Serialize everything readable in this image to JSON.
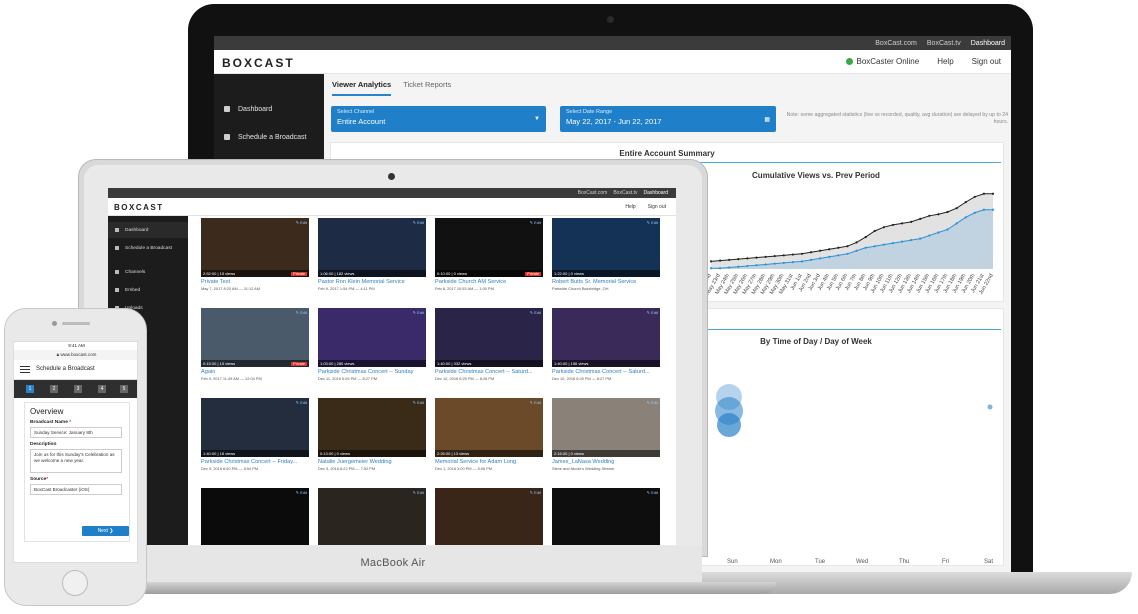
{
  "pro": {
    "topbar": [
      "BoxCast.com",
      "BoxCast.tv",
      "Dashboard"
    ],
    "logo": "BOXCAST",
    "status": "BoxCaster Online",
    "help": "Help",
    "signout": "Sign out",
    "sidebar": [
      "Dashboard",
      "Schedule a Broadcast"
    ],
    "tabs": [
      "Viewer Analytics",
      "Ticket Reports"
    ],
    "channel_label": "Select Channel",
    "channel_value": "Entire Account",
    "date_label": "Select Date Range",
    "date_value": "May 22, 2017 - Jun 22, 2017",
    "note": "Note: some aggregated statistics (live vs recorded, quality, avg duration) are delayed by up to 24 hours.",
    "summary_title": "Entire Account Summary",
    "cumulative_title": "Cumulative Views vs. Prev Period",
    "x_dates": [
      "May 22nd",
      "May 23rd",
      "May 24th",
      "May 25th",
      "May 26th",
      "May 27th",
      "May 28th",
      "May 29th",
      "May 30th",
      "May 31st",
      "Jun 1st",
      "Jun 2nd",
      "Jun 3rd",
      "Jun 4th",
      "Jun 5th",
      "Jun 6th",
      "Jun 7th",
      "Jun 8th",
      "Jun 9th",
      "Jun 10th",
      "Jun 11th",
      "Jun 12th",
      "Jun 13th",
      "Jun 14th",
      "Jun 15th",
      "Jun 16th",
      "Jun 17th",
      "Jun 18th",
      "Jun 19th",
      "Jun 20th",
      "Jun 21st",
      "Jun 22nd"
    ],
    "time_title": "By Time of Day / Day of Week",
    "days": [
      "Sun",
      "Mon",
      "Tue",
      "Wed",
      "Thu",
      "Fri",
      "Sat"
    ]
  },
  "chart_data": {
    "type": "area",
    "title": "Cumulative Views vs. Prev Period",
    "series": [
      {
        "color": "#8c8c8c",
        "values": [
          10,
          11,
          12,
          13,
          14,
          15,
          16,
          17,
          18,
          19,
          20,
          22,
          24,
          26,
          28,
          30,
          35,
          42,
          50,
          55,
          58,
          60,
          62,
          66,
          70,
          72,
          75,
          80,
          88,
          95,
          99,
          99
        ]
      },
      {
        "color": "#2a92d8",
        "values": [
          1,
          1,
          2,
          3,
          4,
          5,
          6,
          7,
          8,
          9,
          10,
          12,
          14,
          16,
          18,
          20,
          24,
          28,
          30,
          32,
          34,
          36,
          38,
          40,
          44,
          48,
          52,
          60,
          68,
          74,
          78,
          78
        ]
      }
    ]
  },
  "air": {
    "topbar": [
      "BoxCast.com",
      "BoxCast.tv",
      "Dashboard"
    ],
    "logo": "BOXCAST",
    "help": "Help",
    "signout": "Sign out",
    "sidebar": [
      "Dashboard",
      "Schedule a Broadcast",
      "Channels",
      "Embed",
      "Uploads",
      "Player"
    ],
    "videos": [
      {
        "title": "Private Test",
        "date": "May 7, 2017 8:20 AM — 11:12 AM",
        "meta": "2:52:00 | 15 views",
        "private": true,
        "bg": "#3c2a1d"
      },
      {
        "title": "Pastor Ron Klein Memorial Service",
        "date": "Feb 9, 2017 1:54 PM — 4:11 PM",
        "meta": "1:06:00 | 182 views",
        "private": false,
        "bg": "#1d2b45"
      },
      {
        "title": "Parkside Church AM Service",
        "date": "Feb 8, 2017 10:53 AM — 1:00 PM",
        "meta": "0:10:00 | 0 views",
        "private": true,
        "bg": "#111111"
      },
      {
        "title": "Robert Butts Sr. Memorial Service",
        "date": "Parkside Church Bainbridge, OH",
        "meta": "1:22:00 | 0 views",
        "private": false,
        "bg": "#143256"
      },
      {
        "title": "Again",
        "date": "Feb 9, 2017 11:49 AM — 12:04 PM",
        "meta": "0:15:00 | 15 views",
        "private": true,
        "bg": "#4a5a6a"
      },
      {
        "title": "Parkside Christmas Concert -- Sunday",
        "date": "Dec 11, 2016 5:26 PM — 8:27 PM",
        "meta": "1:03:00 | 280 views",
        "private": false,
        "bg": "#3a2a6a"
      },
      {
        "title": "Parkside Christmas Concert -- Saturd...",
        "date": "Dec 10, 2016 6:25 PM — 8:26 PM",
        "meta": "1:40:00 | 332 views",
        "private": false,
        "bg": "#2a2548"
      },
      {
        "title": "Parkside Christmas Concert -- Saturd...",
        "date": "Dec 10, 2016 6:25 PM — 8:27 PM",
        "meta": "1:40:00 | 156 views",
        "private": false,
        "bg": "#3a2a5a"
      },
      {
        "title": "Parkside Christmas Concert -- Friday...",
        "date": "Dec 9, 2016 6:50 PM — 8:54 PM",
        "meta": "1:40:00 | 18 views",
        "private": false,
        "bg": "#232d3d"
      },
      {
        "title": "Natalie Juergemeier Wedding",
        "date": "Dec 3, 2016 6:22 PM — 7:52 PM",
        "meta": "0:13:00 | 0 views",
        "private": false,
        "bg": "#3a2a18"
      },
      {
        "title": "Memorial Service for Adam Long",
        "date": "Dec 1, 2016 3:00 PM — 5:06 PM",
        "meta": "2:26:00 | 13 views",
        "private": false,
        "bg": "#6a4a28"
      },
      {
        "title": "James_LaNasa Wedding",
        "date": "Steve and Nicole's Wedding Stream",
        "meta": "2:16:00 | 0 views",
        "private": false,
        "bg": "#8a8278"
      },
      {
        "title": "",
        "date": "",
        "meta": "",
        "private": false,
        "bg": "#0b0b0b"
      },
      {
        "title": "",
        "date": "",
        "meta": "",
        "private": false,
        "bg": "#2b2520"
      },
      {
        "title": "",
        "date": "",
        "meta": "",
        "private": false,
        "bg": "#3a2618"
      },
      {
        "title": "",
        "date": "",
        "meta": "",
        "private": false,
        "bg": "#0e0e0e"
      }
    ],
    "brand": "MacBook Air"
  },
  "phone": {
    "time": "9:41 AM",
    "url": "www.boxcast.com",
    "title": "Schedule a Broadcast",
    "steps": [
      "1",
      "2",
      "3",
      "4",
      "5"
    ],
    "heading": "Overview",
    "name_label": "Broadcast Name",
    "name_value": "Sunday Service: January 8th",
    "desc_label": "Description",
    "desc_value": "Join us for this Sunday's Celebration as we welcome a new year.",
    "source_label": "Source",
    "source_value": "BoxCast Broadcaster (iOS)",
    "next": "Next ❯"
  }
}
